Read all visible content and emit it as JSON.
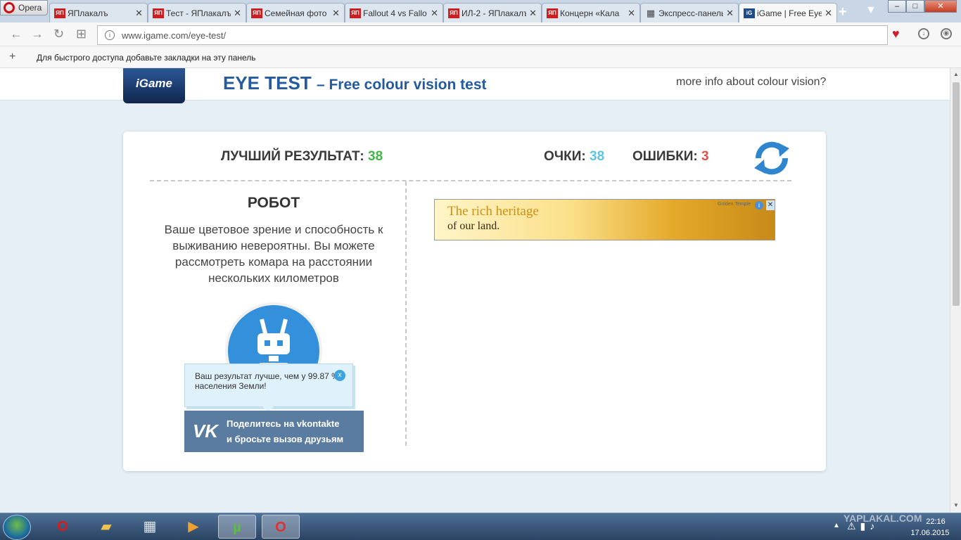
{
  "browser": {
    "menu_label": "Opera",
    "tabs": [
      {
        "fav": "ЯП",
        "title": "ЯПлакалъ",
        "active": false
      },
      {
        "fav": "ЯП",
        "title": "Тест - ЯПлакалъ",
        "active": false
      },
      {
        "fav": "ЯП",
        "title": "Семейная фото",
        "active": false
      },
      {
        "fav": "ЯП",
        "title": "Fallout 4 vs Fallo",
        "active": false
      },
      {
        "fav": "ЯП",
        "title": "ИЛ-2 - ЯПлакалъ",
        "active": false
      },
      {
        "fav": "ЯП",
        "title": "Концерн «Кала",
        "active": false
      },
      {
        "fav": "▦",
        "title": "Экспресс-панель",
        "active": false
      },
      {
        "fav": "iG",
        "title": "iGame | Free Eye",
        "active": true
      }
    ],
    "new_tab_glyph": "+",
    "close_glyph": "✕",
    "url": "www.igame.com/eye-test/",
    "bookmarks_hint": "Для быстрого доступа добавьте закладки на эту панель",
    "bookmarks_plus": "+"
  },
  "header": {
    "logo_text": "iGame",
    "title": "EYE TEST",
    "subtitle": "– Free colour vision test",
    "info_link": "more info about colour vision?"
  },
  "stats": {
    "best_label": "ЛУЧШИЙ РЕЗУЛЬТАТ:",
    "best_value": "38",
    "score_label": "ОЧКИ:",
    "score_value": "38",
    "errors_label": "ОШИБКИ:",
    "errors_value": "3"
  },
  "result": {
    "rank": "РОБОТ",
    "description": "Ваше цветовое зрение и способность к выживанию невероятны. Вы можете рассмотреть комара на расстоянии нескольких километров",
    "tooltip": "Ваш результат лучше, чем у 99.87 % населения Земли!",
    "tooltip_close": "x",
    "vk_logo": "VK",
    "vk_line1": "Поделитесь на vkontakte",
    "vk_line2": "и бросьте вызов друзьям"
  },
  "ad": {
    "headline": "The rich heritage",
    "subline": "of our land.",
    "tag": "Golden Temple",
    "info_glyph": "i",
    "close_glyph": "✕"
  },
  "taskbar": {
    "time": "22:16",
    "date": "17.06.2015",
    "watermark": "YAPLAKAL.COM"
  },
  "colors": {
    "accent": "#245aa0",
    "best": "#43b649",
    "score": "#5bc4e6",
    "errors": "#d9534f",
    "vk": "#5a7ca1"
  }
}
